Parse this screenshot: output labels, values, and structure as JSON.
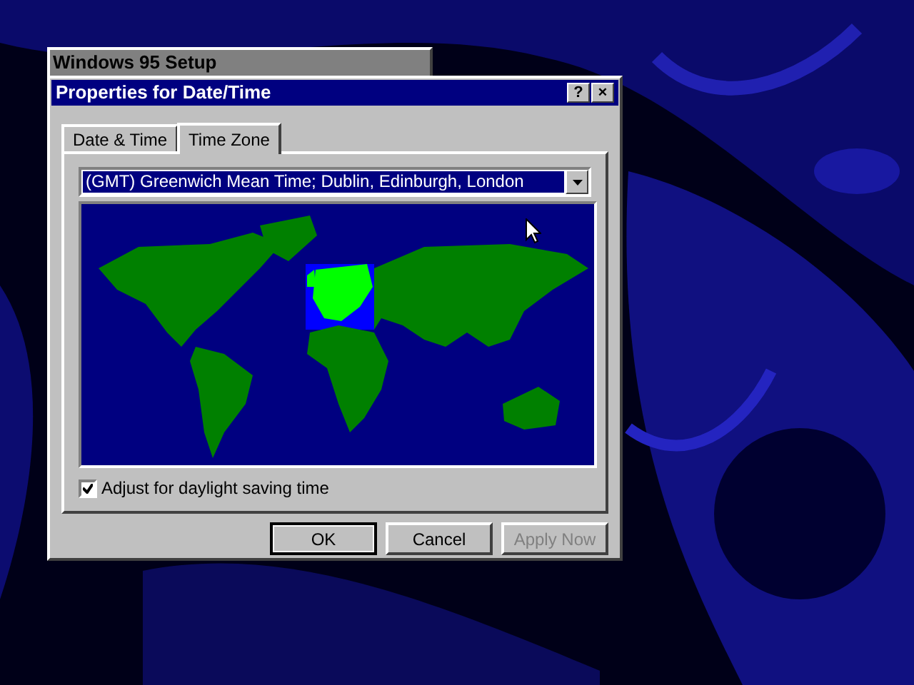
{
  "background_window": {
    "title": "Windows 95 Setup"
  },
  "dialog": {
    "title": "Properties for Date/Time",
    "title_buttons": [
      "?",
      "×"
    ]
  },
  "tabs": [
    {
      "label": "Date & Time",
      "selected": false
    },
    {
      "label": "Time Zone",
      "selected": true
    }
  ],
  "time_zone": {
    "value": "(GMT) Greenwich Mean Time; Dublin, Edinburgh, London"
  },
  "daylight_saving": {
    "label": "Adjust for daylight saving time",
    "checked": true
  },
  "buttons": [
    {
      "label": "OK",
      "default": true,
      "disabled": false
    },
    {
      "label": "Cancel",
      "default": false,
      "disabled": false
    },
    {
      "label": "Apply Now",
      "default": false,
      "disabled": true
    }
  ]
}
